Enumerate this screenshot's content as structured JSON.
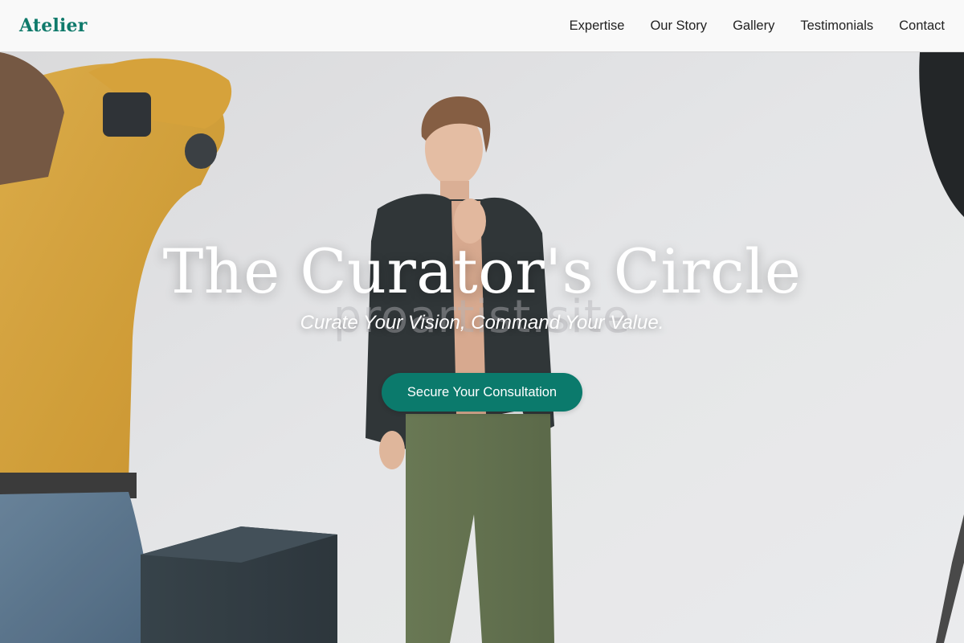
{
  "brand": {
    "name": "Atelier",
    "color": "#0f7a6b"
  },
  "nav": {
    "links": [
      {
        "label": "Expertise"
      },
      {
        "label": "Our Story"
      },
      {
        "label": "Gallery"
      },
      {
        "label": "Testimonials"
      },
      {
        "label": "Contact"
      }
    ]
  },
  "hero": {
    "title": "The Curator's Circle",
    "subtitle": "Curate Your Vision, Command Your Value.",
    "watermark": "proartist.site",
    "cta_label": "Secure Your Consultation",
    "cta_color": "#0b7a6c"
  }
}
